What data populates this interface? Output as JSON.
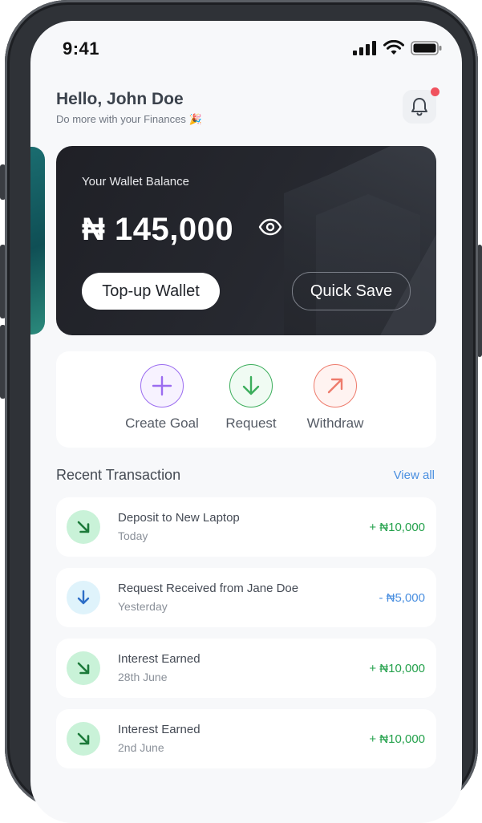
{
  "status_bar": {
    "time": "9:41"
  },
  "header": {
    "greeting": "Hello, John Doe",
    "subtitle": "Do more with your Finances 🎉"
  },
  "wallet": {
    "label": "Your Wallet Balance",
    "amount": "₦ 145,000",
    "topup_label": "Top-up Wallet",
    "quick_save_label": "Quick Save"
  },
  "actions": [
    {
      "label": "Create Goal",
      "icon": "plus-icon",
      "color": "#9b6cf0"
    },
    {
      "label": "Request",
      "icon": "arrow-down-icon",
      "color": "#3cae5c"
    },
    {
      "label": "Withdraw",
      "icon": "arrow-up-right-icon",
      "color": "#ee7b6c"
    }
  ],
  "transactions_section": {
    "title": "Recent Transaction",
    "view_all": "View all"
  },
  "transactions": [
    {
      "title": "Deposit to New Laptop",
      "date": "Today",
      "amount": "+ ₦10,000",
      "type": "credit"
    },
    {
      "title": "Request Received from Jane Doe",
      "date": "Yesterday",
      "amount": "- ₦5,000",
      "type": "request"
    },
    {
      "title": "Interest Earned",
      "date": "28th June",
      "amount": "+ ₦10,000",
      "type": "credit"
    },
    {
      "title": "Interest Earned",
      "date": "2nd June",
      "amount": "+ ₦10,000",
      "type": "credit"
    }
  ],
  "colors": {
    "credit": "#24a14c",
    "request": "#4a8fe0",
    "credit_bg": "#c9f2d8",
    "request_bg": "#dff3fb",
    "accent": "#4a8fe0"
  }
}
